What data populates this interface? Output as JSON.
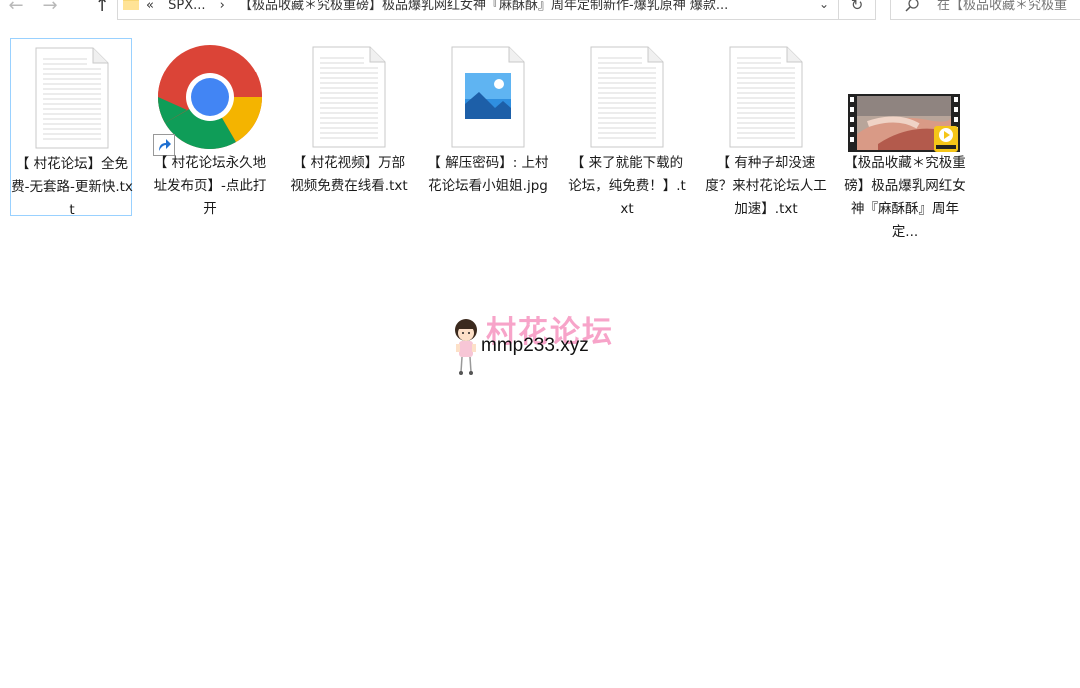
{
  "nav": {
    "back_icon": "←",
    "forward_icon": "→",
    "up_icon": "↑"
  },
  "address_bar": {
    "crumbs": [
      "«",
      "SPX...",
      "›",
      "【极品收藏＊究极重磅】极品爆乳网红女神『麻酥酥』周年定制新作-爆乳原神 爆款..."
    ],
    "dropdown_icon": "⌄",
    "refresh_icon": "↻"
  },
  "search": {
    "placeholder": "在【极品收藏＊究极重"
  },
  "files": [
    {
      "name": "【 村花论坛】全免费-无套路-更新快.txt",
      "type": "txt",
      "selected": true
    },
    {
      "name": "【 村花论坛永久地址发布页】-点此打开",
      "type": "chrome-shortcut",
      "selected": false
    },
    {
      "name": "【 村花视频】万部视频免费在线看.txt",
      "type": "txt",
      "selected": false
    },
    {
      "name": "【 解压密码】: 上村花论坛看小姐姐.jpg",
      "type": "jpg",
      "selected": false
    },
    {
      "name": "【 来了就能下载的论坛，纯免费！】.txt",
      "type": "txt",
      "selected": false
    },
    {
      "name": "【 有种子却没速度？来村花论坛人工加速】.txt",
      "type": "txt",
      "selected": false
    },
    {
      "name": "【极品收藏＊究极重磅】极品爆乳网红女神『麻酥酥』周年定...",
      "type": "video",
      "selected": false
    }
  ],
  "watermark": {
    "text": "村花论坛",
    "url": "mmp233.xyz"
  },
  "colors": {
    "selection_border": "#99d1ff",
    "watermark_pink": "#f25a9e",
    "player_badge": "#f5c518"
  }
}
